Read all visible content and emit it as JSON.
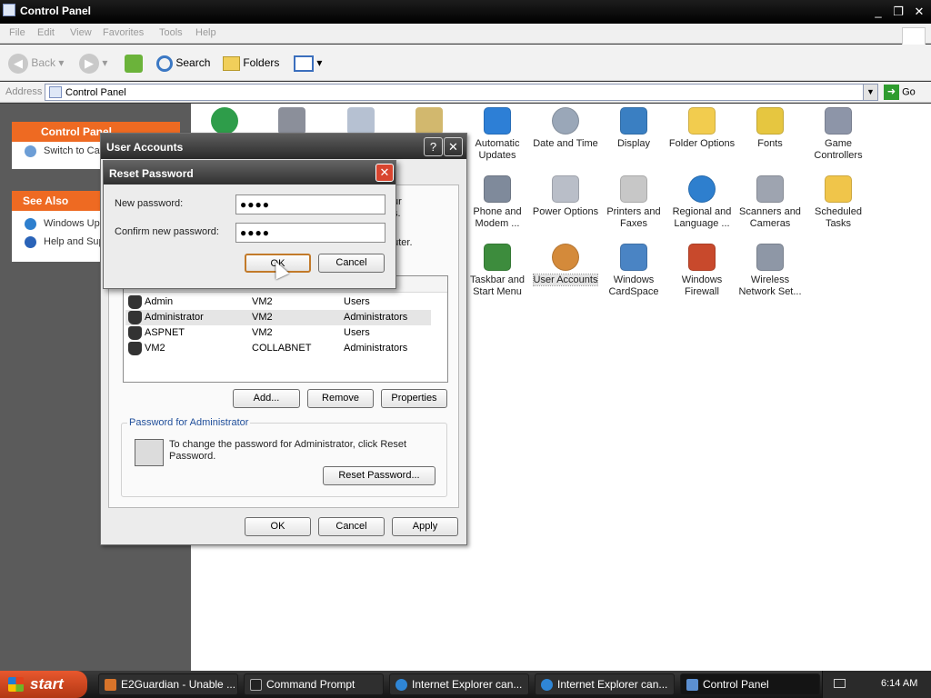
{
  "window": {
    "title": "Control Panel",
    "menu": [
      "File",
      "Edit",
      "View",
      "Favorites",
      "Tools",
      "Help"
    ],
    "toolbar": {
      "back": "Back",
      "search": "Search",
      "folders": "Folders"
    },
    "address": {
      "label": "Address",
      "value": "Control Panel",
      "go": "Go"
    }
  },
  "taskpane": {
    "control_panel": {
      "title": "Control Panel",
      "switch_label": "Switch to Cat"
    },
    "see_also": {
      "title": "See Also",
      "items": [
        "Windows Upd",
        "Help and Sup"
      ]
    }
  },
  "control_panel_items": [
    {
      "label": "Automatic Updates",
      "icon": "automatic-updates-icon",
      "color": "#2d7fd6"
    },
    {
      "label": "Date and Time",
      "icon": "date-time-icon",
      "color": "#9aa7b8"
    },
    {
      "label": "Display",
      "icon": "display-icon",
      "color": "#3a7fc2"
    },
    {
      "label": "Folder Options",
      "icon": "folder-options-icon",
      "color": "#f2cc4e"
    },
    {
      "label": "Fonts",
      "icon": "fonts-icon",
      "color": "#e6c640"
    },
    {
      "label": "Game Controllers",
      "icon": "game-controllers-icon",
      "color": "#8d95a8"
    },
    {
      "label": "Phone and Modem ...",
      "icon": "phone-modem-icon",
      "color": "#7f8a9b"
    },
    {
      "label": "Power Options",
      "icon": "power-options-icon",
      "color": "#b9bec8"
    },
    {
      "label": "Printers and Faxes",
      "icon": "printers-icon",
      "color": "#c7c7c7"
    },
    {
      "label": "Regional and Language ...",
      "icon": "globe-icon",
      "color": "#2e7fce"
    },
    {
      "label": "Scanners and Cameras",
      "icon": "scanner-icon",
      "color": "#9ea4b0"
    },
    {
      "label": "Scheduled Tasks",
      "icon": "scheduled-tasks-icon",
      "color": "#f0c54a"
    },
    {
      "label": "Taskbar and Start Menu",
      "icon": "taskbar-icon",
      "color": "#3d8c3d"
    },
    {
      "label": "User Accounts",
      "icon": "user-accounts-icon",
      "color": "#d48a3a"
    },
    {
      "label": "Windows CardSpace",
      "icon": "cardspace-icon",
      "color": "#4a84c4"
    },
    {
      "label": "Windows Firewall",
      "icon": "firewall-icon",
      "color": "#c8492c"
    },
    {
      "label": "Wireless Network Set...",
      "icon": "wireless-icon",
      "color": "#8e97a6"
    }
  ],
  "user_accounts_dialog": {
    "title": "User Accounts",
    "partial_text_1": "ur",
    "partial_text_2": "s.",
    "partial_text_3": "puter.",
    "users": [
      {
        "name": "Admin",
        "domain": "VM2",
        "group": "Users"
      },
      {
        "name": "Administrator",
        "domain": "VM2",
        "group": "Administrators"
      },
      {
        "name": "ASPNET",
        "domain": "VM2",
        "group": "Users"
      },
      {
        "name": "VM2",
        "domain": "COLLABNET",
        "group": "Administrators"
      }
    ],
    "buttons": {
      "add": "Add...",
      "remove": "Remove",
      "properties": "Properties",
      "ok": "OK",
      "cancel": "Cancel",
      "apply": "Apply"
    },
    "password_group": {
      "title": "Password for Administrator",
      "text": "To change the password for Administrator, click Reset Password.",
      "reset_button": "Reset Password..."
    }
  },
  "reset_password_dialog": {
    "title": "Reset Password",
    "new_password_label": "New password:",
    "new_password_value": "●●●●",
    "confirm_password_label": "Confirm new password:",
    "confirm_password_value": "●●●●",
    "ok": "OK",
    "cancel": "Cancel"
  },
  "taskbar": {
    "start": "start",
    "tasks": [
      {
        "label": "E2Guardian - Unable ...",
        "icon": "firefox-icon",
        "color": "#d8742a"
      },
      {
        "label": "Command Prompt",
        "icon": "cmd-icon",
        "color": "#222222"
      },
      {
        "label": "Internet Explorer can...",
        "icon": "ie-icon",
        "color": "#2f86d6"
      },
      {
        "label": "Internet Explorer can...",
        "icon": "ie-icon",
        "color": "#2f86d6"
      },
      {
        "label": "Control Panel",
        "icon": "control-panel-icon",
        "color": "#5c8fd0"
      }
    ],
    "clock": "6:14 AM"
  }
}
